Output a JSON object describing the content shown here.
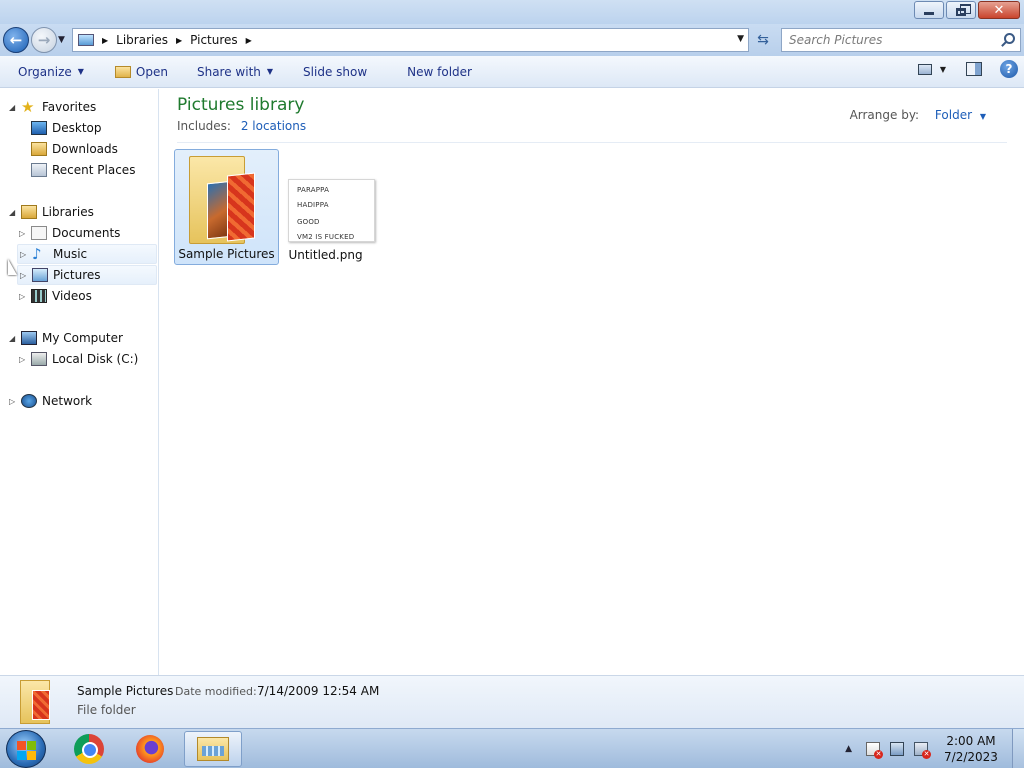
{
  "address": {
    "crumbs": [
      "Libraries",
      "Pictures"
    ],
    "search_placeholder": "Search Pictures"
  },
  "toolbar": {
    "organize": "Organize",
    "open": "Open",
    "share_with": "Share with",
    "slide_show": "Slide show",
    "new_folder": "New folder"
  },
  "nav": {
    "favorites": "Favorites",
    "desktop": "Desktop",
    "downloads": "Downloads",
    "recent_places": "Recent Places",
    "libraries": "Libraries",
    "documents": "Documents",
    "music": "Music",
    "pictures": "Pictures",
    "videos": "Videos",
    "my_computer": "My Computer",
    "local_disk": "Local Disk (C:)",
    "network": "Network"
  },
  "content": {
    "title": "Pictures library",
    "includes_label": "Includes:",
    "includes_link": "2 locations",
    "arrange_label": "Arrange by:",
    "arrange_value": "Folder",
    "items": [
      {
        "name": "Sample Pictures",
        "kind": "folder"
      },
      {
        "name": "Untitled.png",
        "kind": "image",
        "thumb_lines": [
          "PARAPPA",
          "HADIPPA",
          "GOOD",
          "VM2 IS FUCKED"
        ]
      }
    ]
  },
  "details": {
    "name": "Sample Pictures",
    "modified_label": "Date modified:",
    "modified_value": "7/14/2009 12:54 AM",
    "type": "File folder"
  },
  "taskbar": {
    "time": "2:00 AM",
    "date": "7/2/2023"
  }
}
